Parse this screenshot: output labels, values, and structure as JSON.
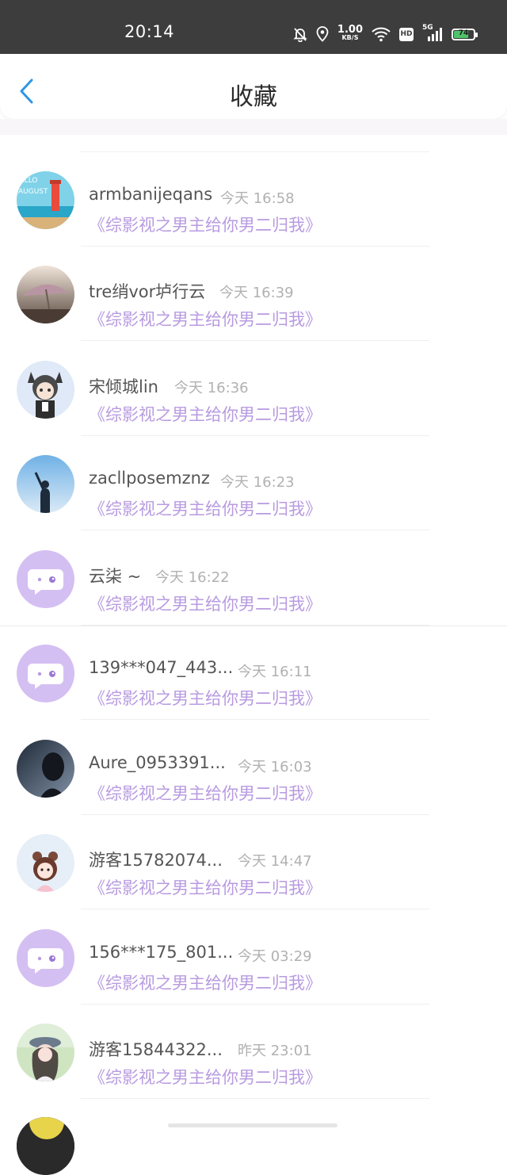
{
  "status_bar": {
    "time": "20:14",
    "speed_value": "1.00",
    "speed_unit": "KB/S",
    "network": "5G",
    "hd": "HD",
    "battery": "74",
    "battery_level": 0.74
  },
  "header": {
    "title": "收藏",
    "back_icon": "chevron-left-icon"
  },
  "items": [
    {
      "name": "armbanijeqans",
      "time": "今天 16:58",
      "book": "《综影视之男主给你男二归我》",
      "avatar": "photo-lighthouse"
    },
    {
      "name": "tre绡vor垆行云",
      "time": "今天 16:39",
      "book": "《综影视之男主给你男二归我》",
      "avatar": "photo-umbrella"
    },
    {
      "name": "宋倾城lin",
      "time": "今天 16:36",
      "book": "《综影视之男主给你男二归我》",
      "avatar": "anime-cat-girl"
    },
    {
      "name": "zacllposemznz",
      "time": "今天 16:23",
      "book": "《综影视之男主给你男二归我》",
      "avatar": "photo-sky-silhouette"
    },
    {
      "name": "云柒 ~",
      "time": "今天 16:22",
      "book": "《综影视之男主给你男二归我》",
      "avatar": "default-chat"
    },
    {
      "name": "139***047_443...",
      "time": "今天 16:11",
      "book": "《综影视之男主给你男二归我》",
      "avatar": "default-chat"
    },
    {
      "name": "Aure_0953391...",
      "time": "今天 16:03",
      "book": "《综影视之男主给你男二归我》",
      "avatar": "photo-dark-portrait"
    },
    {
      "name": "游客15782074...",
      "time": "今天 14:47",
      "book": "《综影视之男主给你男二归我》",
      "avatar": "anime-girl-bear"
    },
    {
      "name": "156***175_801...",
      "time": "今天 03:29",
      "book": "《综影视之男主给你男二归我》",
      "avatar": "default-chat"
    },
    {
      "name": "游客15844322...",
      "time": "昨天 23:01",
      "book": "《综影视之男主给你男二归我》",
      "avatar": "photo-girl-hat"
    }
  ],
  "colors": {
    "status_bar": "#3d3d3d",
    "accent_blue": "#2f96e6",
    "book_title": "#b89be0",
    "default_avatar_bg": "#d4bff2"
  }
}
